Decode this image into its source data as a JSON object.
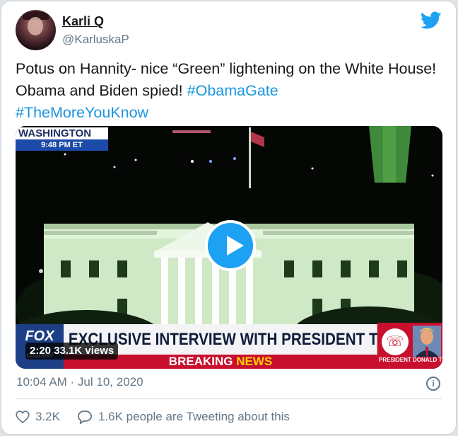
{
  "author": {
    "name": "Karli Q",
    "handle": "@KarluskaP"
  },
  "icons": {
    "brand": "twitter-bird-icon",
    "play": "play-icon",
    "like": "heart-icon",
    "reply": "speech-bubble-icon",
    "info": "info-icon",
    "phone": "phone-icon"
  },
  "tweet": {
    "text_part1": "Potus on Hannity- nice “Green”  lightening on the White House! Obama and Biden spied! ",
    "hashtag1": "#ObamaGate",
    "hashtag2": "#TheMoreYouKnow"
  },
  "video": {
    "location": "WASHINGTON",
    "local_time": "9:48 PM ET",
    "network_logo": "FOX",
    "network_sub": "channel",
    "chyron": "EXCLUSIVE INTERVIEW WITH PRESIDENT TRUMP",
    "breaking_label": "BREAKING",
    "news_label": "NEWS",
    "guest_label": "PRESIDENT DONALD TR",
    "duration": "2:20",
    "views": "33.1K views"
  },
  "meta": {
    "timestamp": "10:04 AM · Jul 10, 2020"
  },
  "actions": {
    "likes": "3.2K",
    "tweeting_text": "1.6K people are Tweeting about this"
  },
  "colors": {
    "accent": "#1da1f2",
    "hashtag": "#1b95e0",
    "muted": "#657786",
    "breaking_red": "#c8102e",
    "fox_blue": "#1c3f86"
  }
}
